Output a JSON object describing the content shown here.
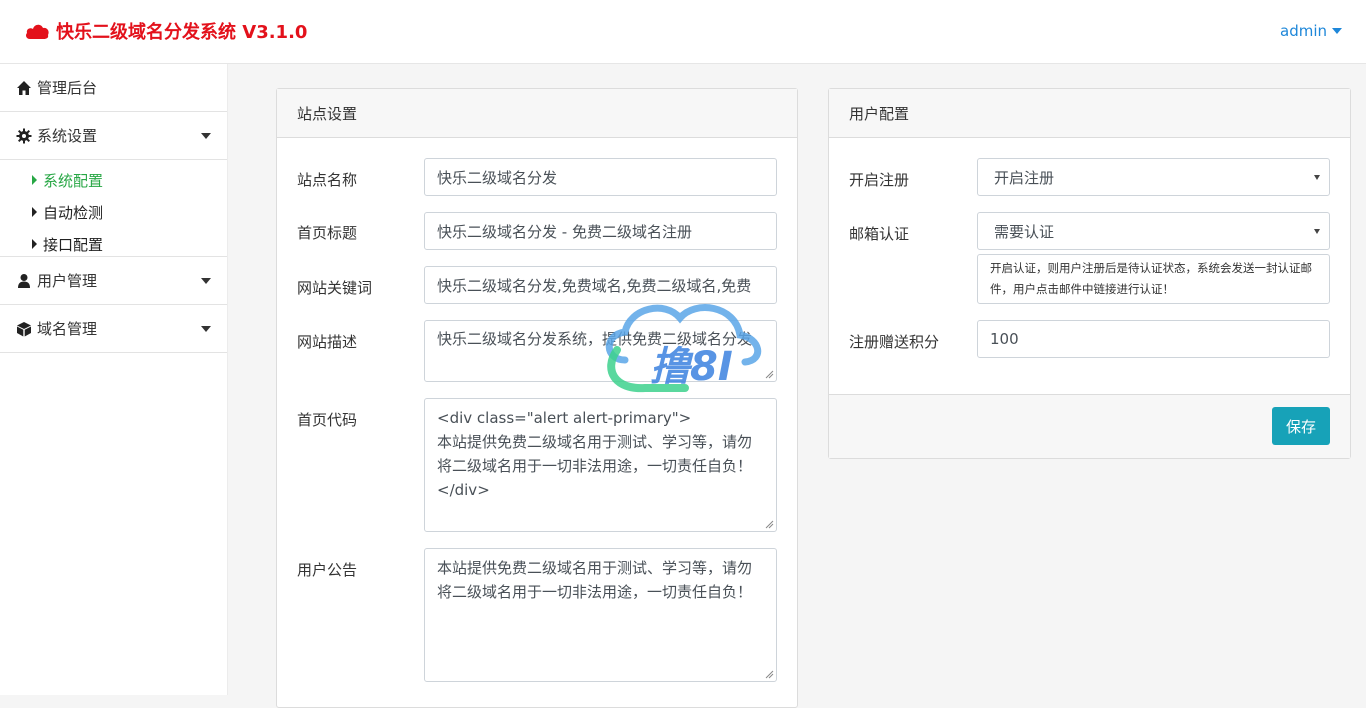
{
  "app": {
    "title": "快乐二级域名分发系统 V3.1.0",
    "brand_color": "#e3111b",
    "logo_icon": "cloud-icon"
  },
  "header": {
    "user": "admin"
  },
  "sidebar": {
    "items": [
      {
        "label": "管理后台",
        "icon": "home-icon"
      },
      {
        "label": "系统设置",
        "icon": "gear-icon",
        "expanded": true,
        "children": [
          {
            "label": "系统配置",
            "active": true
          },
          {
            "label": "自动检测"
          },
          {
            "label": "接口配置"
          }
        ]
      },
      {
        "label": "用户管理",
        "icon": "user-icon"
      },
      {
        "label": "域名管理",
        "icon": "cube-icon"
      }
    ],
    "active_color": "#28a745"
  },
  "site_settings": {
    "title": "站点设置",
    "fields": [
      {
        "label": "站点名称",
        "value": "快乐二级域名分发"
      },
      {
        "label": "首页标题",
        "value": "快乐二级域名分发 - 免费二级域名注册"
      },
      {
        "label": "网站关键词",
        "value": "快乐二级域名分发,免费域名,免费二级域名,免费"
      },
      {
        "label": "网站描述",
        "value": "快乐二级域名分发系统，提供免费二级域名分发"
      },
      {
        "label": "首页代码",
        "value": "<div class=\"alert alert-primary\">\n本站提供免费二级域名用于测试、学习等，请勿将二级域名用于一切非法用途，一切责任自负！\n</div>"
      },
      {
        "label": "用户公告",
        "value": "本站提供免费二级域名用于测试、学习等，请勿将二级域名用于一切非法用途，一切责任自负！"
      }
    ]
  },
  "user_config": {
    "title": "用户配置",
    "register": {
      "label": "开启注册",
      "selected": "开启注册"
    },
    "email_verify": {
      "label": "邮箱认证",
      "selected": "需要认证",
      "help": "开启认证，则用户注册后是待认证状态，系统会发送一封认证邮件，用户点击邮件中链接进行认证！"
    },
    "bonus": {
      "label": "注册赠送积分",
      "value": "100"
    },
    "save_label": "保存",
    "save_color": "#17a2b8"
  },
  "watermark": {
    "text": "撸8I"
  }
}
